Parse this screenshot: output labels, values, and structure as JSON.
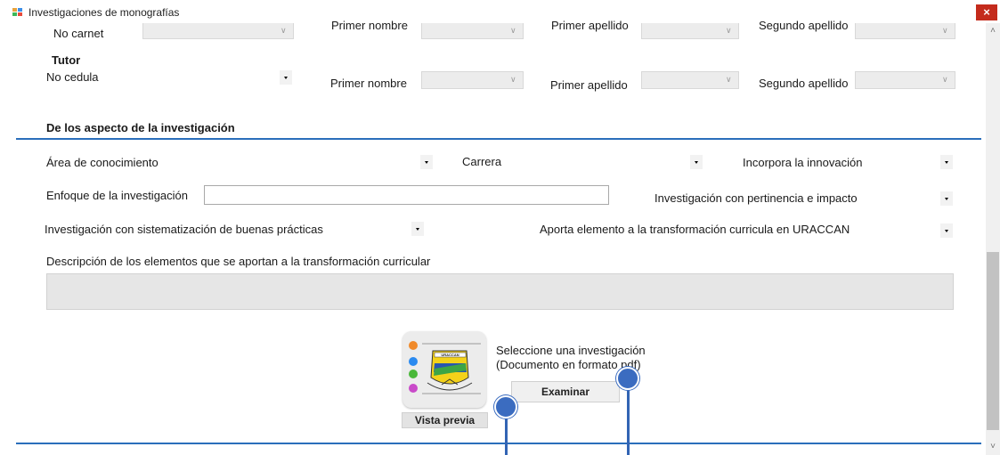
{
  "window": {
    "title": "Investigaciones de monografías",
    "close_glyph": "×"
  },
  "student_row": {
    "carnet_label": "No carnet",
    "primer_nombre_label": "Primer nombre",
    "primer_apellido_label": "Primer apellido",
    "segundo_apellido_label": "Segundo apellido"
  },
  "tutor": {
    "heading": "Tutor",
    "cedula_label": "No cedula",
    "primer_nombre_label": "Primer nombre",
    "primer_apellido_label": "Primer apellido",
    "segundo_apellido_label": "Segundo apellido"
  },
  "section": {
    "heading": "De los aspecto de la investigación"
  },
  "fields": {
    "area_label": "Área de conocimiento",
    "carrera_label": "Carrera",
    "innovacion_label": "Incorpora la innovación",
    "enfoque_label": "Enfoque de la investigación",
    "enfoque_value": "",
    "pertinencia_label": "Investigación con pertinencia e impacto",
    "sistematizacion_label": "Investigación con sistematización de buenas prácticas",
    "transformacion_label": "Aporta elemento a la transformación curricula en URACCAN",
    "descripcion_label": "Descripción de los elementos que se aportan a la transformación curricular",
    "descripcion_value": ""
  },
  "document": {
    "instruction_line1": "Seleccione una investigación",
    "instruction_line2": "(Documento en formato pdf)",
    "browse_button": "Examinar",
    "preview_button": "Vista previa",
    "logo_text": "URACCAN"
  },
  "colors": {
    "accent_line": "#2a6ebb",
    "marker": "#3b6cc0",
    "close": "#c42b1c"
  }
}
